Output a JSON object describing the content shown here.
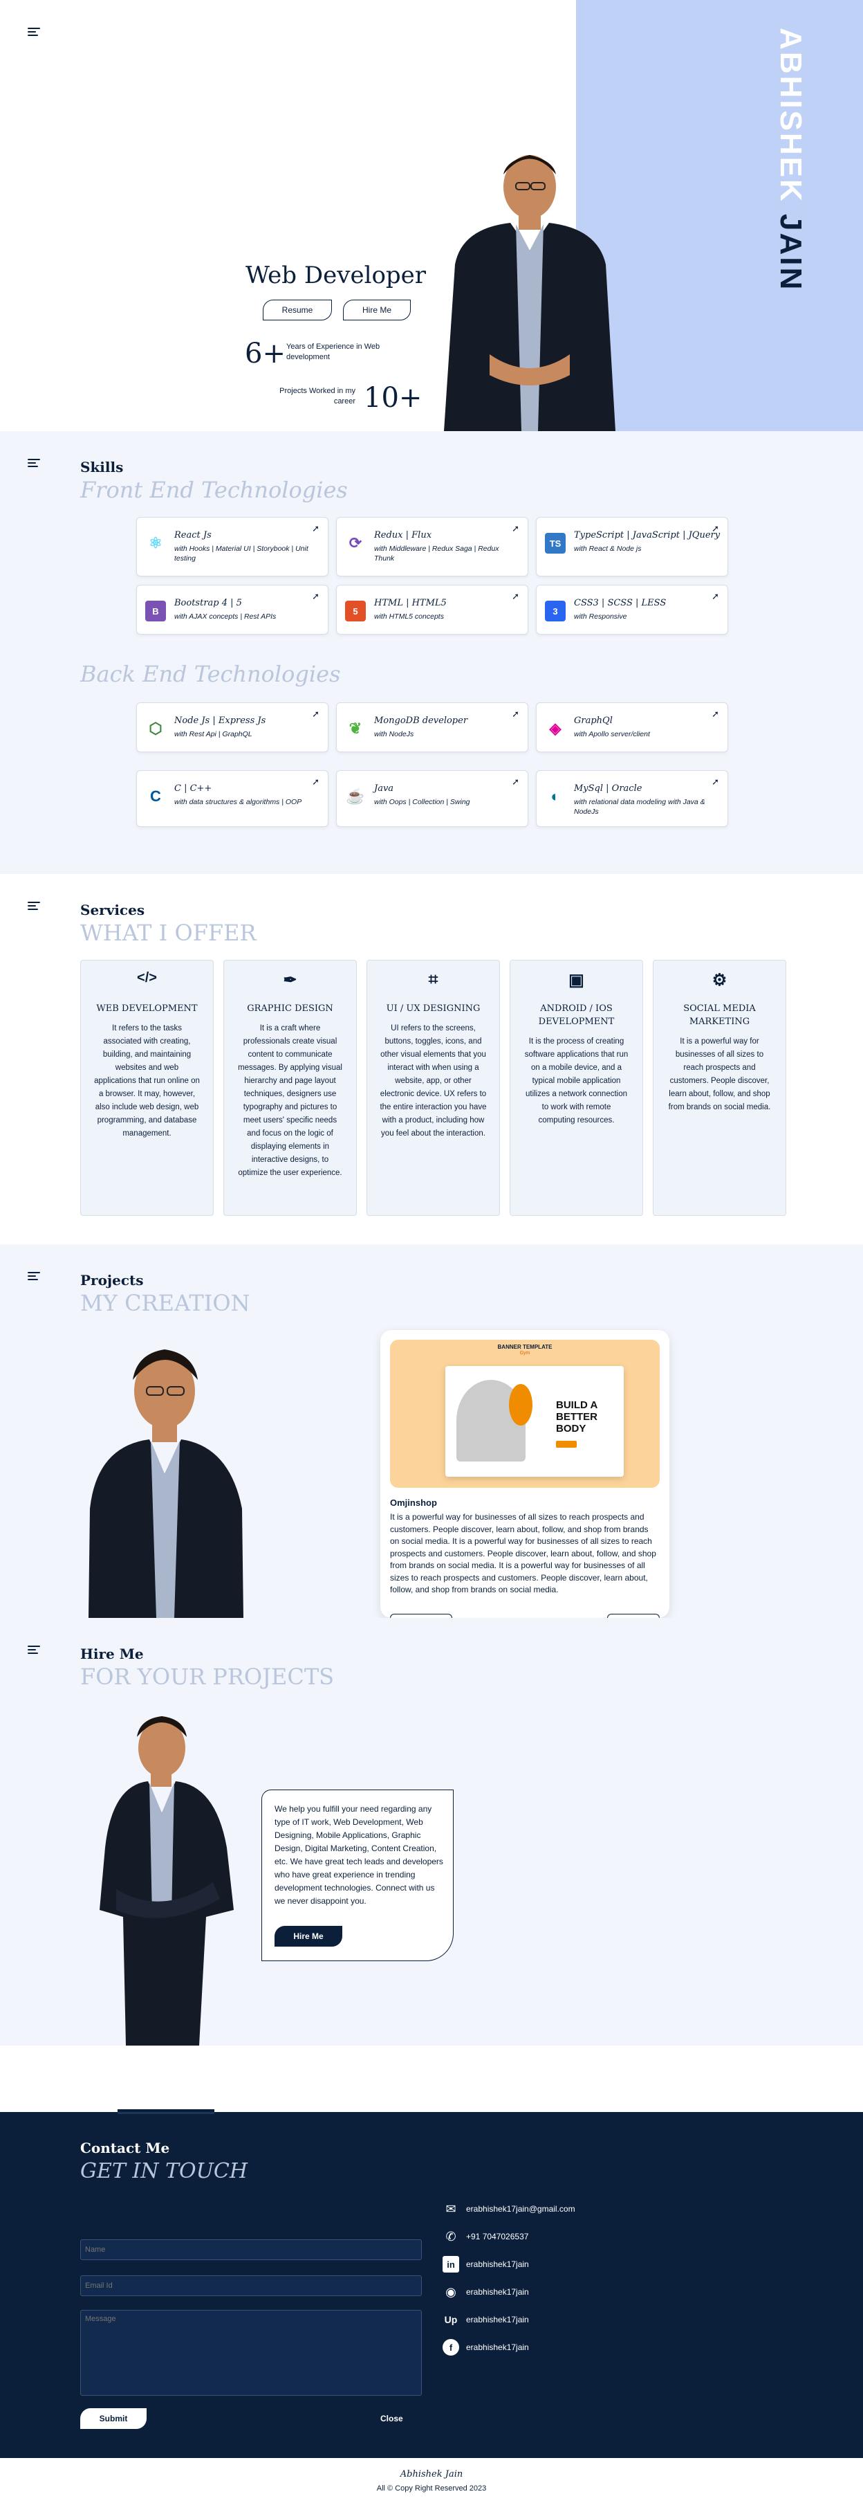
{
  "hero": {
    "name_first": "ABHISHEK",
    "name_last": "JAIN",
    "title": "Web Developer",
    "resume_label": "Resume",
    "hire_label": "Hire Me",
    "exp_value": "6+",
    "exp_text": "Years of Experience in Web development",
    "projects_text": "Projects Worked in my career",
    "projects_value": "10+"
  },
  "skills": {
    "heading": "Skills",
    "frontend_heading": "Front End Technologies",
    "backend_heading": "Back End Technologies",
    "frontend": [
      {
        "title": "React Js",
        "sub": "with Hooks | Material UI | Storybook | Unit testing",
        "icon": "react-icon",
        "color": "#61dafb"
      },
      {
        "title": "Redux | Flux",
        "sub": "with Middleware | Redux Saga | Redux Thunk",
        "icon": "redux-icon",
        "color": "#764abc"
      },
      {
        "title": "TypeScript | JavaScript | JQuery",
        "sub": "with React & Node js",
        "icon": "typescript-icon",
        "color": "#3178c6"
      },
      {
        "title": "Bootstrap 4 | 5",
        "sub": "with AJAX concepts | Rest APIs",
        "icon": "bootstrap-icon",
        "color": "#7952b3"
      },
      {
        "title": "HTML | HTML5",
        "sub": "with HTML5 concepts",
        "icon": "html5-icon",
        "color": "#e34f26"
      },
      {
        "title": "CSS3 | SCSS | LESS",
        "sub": "with Responsive",
        "icon": "css3-icon",
        "color": "#2965f1"
      }
    ],
    "backend": [
      {
        "title": "Node Js | Express Js",
        "sub": "with Rest Api | GraphQL",
        "icon": "nodejs-icon",
        "color": "#3c873a"
      },
      {
        "title": "MongoDB developer",
        "sub": "with NodeJs",
        "icon": "mongodb-icon",
        "color": "#4db33d"
      },
      {
        "title": "GraphQl",
        "sub": "with Apollo server/client",
        "icon": "graphql-icon",
        "color": "#e10098"
      },
      {
        "title": "C | C++",
        "sub": "with data structures & algorithms | OOP",
        "icon": "cpp-icon",
        "color": "#00599c"
      },
      {
        "title": "Java",
        "sub": "with Oops | Collection | Swing",
        "icon": "java-icon",
        "color": "#f89820"
      },
      {
        "title": "MySql | Oracle",
        "sub": "with relational data modeling with Java & NodeJs",
        "icon": "mysql-icon",
        "color": "#00758f"
      }
    ]
  },
  "services": {
    "heading": "Services",
    "subheading": "WHAT I OFFER",
    "items": [
      {
        "icon": "code-icon",
        "title": "WEB DEVELOPMENT",
        "desc": "It refers to the tasks associated with creating, building, and maintaining websites and web applications that run online on a browser. It may, however, also include web design, web programming, and database management."
      },
      {
        "icon": "pen-tool-icon",
        "title": "GRAPHIC DESIGN",
        "desc": "It is a craft where professionals create visual content to communicate messages. By applying visual hierarchy and page layout techniques, designers use typography and pictures to meet users' specific needs and focus on the logic of displaying elements in interactive designs, to optimize the user experience."
      },
      {
        "icon": "ui-design-icon",
        "title": "UI / UX DESIGNING",
        "desc": "UI refers to the screens, buttons, toggles, icons, and other visual elements that you interact with when using a website, app, or other electronic device. UX refers to the entire interaction you have with a product, including how you feel about the interaction."
      },
      {
        "icon": "mobile-dev-icon",
        "title": "ANDROID / IOS DEVELOPMENT",
        "desc": "It is the process of creating software applications that run on a mobile device, and a typical mobile application utilizes a network connection to work with remote computing resources."
      },
      {
        "icon": "marketing-icon",
        "title": "SOCIAL MEDIA MARKETING",
        "desc": "It is a powerful way for businesses of all sizes to reach prospects and customers. People discover, learn about, follow, and shop from brands on social media."
      }
    ]
  },
  "projects": {
    "heading": "Projects",
    "subheading": "MY CREATION",
    "card": {
      "banner_label": "BANNER TEMPLATE",
      "banner_sub": "Gym",
      "banner_headline": "BUILD A BETTER BODY",
      "title": "Omjinshop",
      "desc": "It is a powerful way for businesses of all sizes to reach prospects and customers. People discover, learn about, follow, and shop from brands on social media. It is a powerful way for businesses of all sizes to reach prospects and customers. People discover, learn about, follow, and shop from brands on social media. It is a powerful way for businesses of all sizes to reach prospects and customers. People discover, learn about, follow, and shop from brands on social media."
    }
  },
  "hire": {
    "heading": "Hire Me",
    "subheading": "FOR YOUR PROJECTS",
    "text": "We help you fulfill your need regarding any type of IT work, Web Development, Web Designing, Mobile Applications, Graphic Design, Digital Marketing, Content Creation, etc. We have great tech leads and developers who have great experience in trending development technologies. Connect with us we never disappoint you.",
    "button": "Hire Me"
  },
  "contact": {
    "heading": "Contact Me",
    "subheading": "GET IN TOUCH",
    "name_placeholder": "Name",
    "email_placeholder": "Email Id",
    "message_placeholder": "Message",
    "submit": "Submit",
    "close": "Close",
    "info": [
      {
        "icon": "mail-icon",
        "text": "erabhishek17jain@gmail.com"
      },
      {
        "icon": "phone-icon",
        "text": "+91 7047026537"
      },
      {
        "icon": "linkedin-icon",
        "text": "erabhishek17jain"
      },
      {
        "icon": "github-icon",
        "text": "erabhishek17jain"
      },
      {
        "icon": "upwork-icon",
        "text": "erabhishek17jain"
      },
      {
        "icon": "facebook-icon",
        "text": "erabhishek17jain"
      }
    ]
  },
  "footer": {
    "name": "Abhishek Jain",
    "copyright": "All © Copy Right Reserved 2023"
  }
}
